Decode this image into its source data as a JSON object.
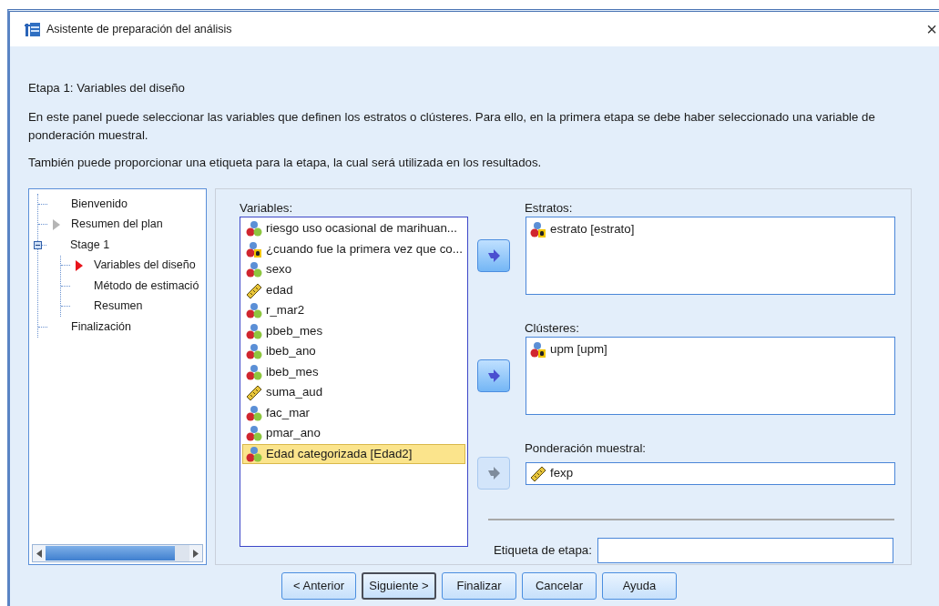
{
  "window": {
    "title": "Asistente de preparación del análisis",
    "close_button": "×"
  },
  "stage_title": "Etapa 1: Variables del diseño",
  "description": [
    "En este panel puede seleccionar las variables que definen los estratos o clústeres. Para ello, en la primera etapa se debe haber seleccionado una variable de ponderación muestral.",
    "También puede proporcionar una etiqueta para la etapa, la cual será utilizada en los resultados."
  ],
  "tree": [
    {
      "label": "Bienvenido",
      "kind": "step"
    },
    {
      "label": "Resumen del plan",
      "kind": "visited"
    },
    {
      "label": "Stage 1",
      "kind": "step",
      "expanded": true,
      "children": [
        {
          "label": "Variables del diseño",
          "kind": "current"
        },
        {
          "label": "Método de estimació",
          "kind": "step"
        },
        {
          "label": "Resumen",
          "kind": "step"
        }
      ]
    },
    {
      "label": "Finalización",
      "kind": "step"
    }
  ],
  "variables": {
    "label": "Variables:",
    "items": [
      {
        "name": "riesgo uso ocasional de marihuan...",
        "kind": "nominal",
        "selected": false
      },
      {
        "name": "¿cuando fue la primera vez que co...",
        "kind": "string",
        "selected": false
      },
      {
        "name": "sexo",
        "kind": "nominal",
        "selected": false
      },
      {
        "name": "edad",
        "kind": "scale",
        "selected": false
      },
      {
        "name": "r_mar2",
        "kind": "nominal",
        "selected": false
      },
      {
        "name": "pbeb_mes",
        "kind": "nominal",
        "selected": false
      },
      {
        "name": "ibeb_ano",
        "kind": "nominal",
        "selected": false
      },
      {
        "name": "ibeb_mes",
        "kind": "nominal",
        "selected": false
      },
      {
        "name": "suma_aud",
        "kind": "scale",
        "selected": false
      },
      {
        "name": "fac_mar",
        "kind": "nominal",
        "selected": false
      },
      {
        "name": "pmar_ano",
        "kind": "nominal",
        "selected": false
      },
      {
        "name": "Edad categorizada [Edad2]",
        "kind": "nominal",
        "selected": true
      }
    ]
  },
  "targets": [
    {
      "label": "Estratos:",
      "kind": "list",
      "arrow_disabled": false,
      "items": [
        {
          "name": "estrato [estrato]",
          "kind": "string"
        }
      ]
    },
    {
      "label": "Clústeres:",
      "kind": "list",
      "arrow_disabled": false,
      "items": [
        {
          "name": "upm [upm]",
          "kind": "string"
        }
      ]
    },
    {
      "label": "Ponderación muestral:",
      "kind": "field",
      "arrow_disabled": true,
      "items": [
        {
          "name": "fexp",
          "kind": "scale"
        }
      ]
    }
  ],
  "stage_label": {
    "label": "Etiqueta de etapa:"
  },
  "buttons": [
    {
      "label": "< Anterior",
      "default": false
    },
    {
      "label": "Siguiente >",
      "default": true
    },
    {
      "label": "Finalizar",
      "default": false
    },
    {
      "label": "Cancelar",
      "default": false
    },
    {
      "label": "Ayuda",
      "default": false
    }
  ]
}
